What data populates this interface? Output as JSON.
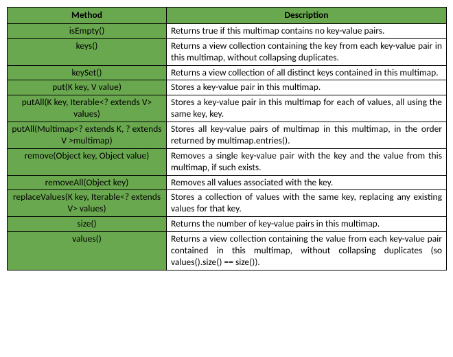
{
  "headers": {
    "method": "Method",
    "description": "Description"
  },
  "rows": [
    {
      "method": "isEmpty()",
      "description": "Returns true if this multimap contains no key-value pairs."
    },
    {
      "method": "keys()",
      "description": "Returns a view collection containing the key from each key-value pair in this multimap, without collapsing duplicates."
    },
    {
      "method": "keySet()",
      "description": "Returns a view collection of all distinct keys contained in this multimap."
    },
    {
      "method": "put(K key, V value)",
      "description": "Stores a key-value pair in this multimap."
    },
    {
      "method": "putAll(K key, Iterable<? extends V> values)",
      "description": "Stores a key-value pair in this multimap for each of values, all using the same key, key."
    },
    {
      "method": "putAll(Multimap<? extends K, ? extends V >multimap)",
      "description": "Stores all key-value pairs of multimap in this multimap, in the order returned by multimap.entries()."
    },
    {
      "method": "remove(Object key, Object value)",
      "description": "Removes a single key-value pair with the key and the value from this multimap, if such exists."
    },
    {
      "method": "removeAll(Object key)",
      "description": "Removes all values associated with the key."
    },
    {
      "method": "replaceValues(K key, Iterable<? extends V> values)",
      "description": "Stores a collection of values with the same key, replacing any existing values for that key."
    },
    {
      "method": "size()",
      "description": "Returns the number of key-value pairs in this multimap."
    },
    {
      "method": "values()",
      "description": "Returns a view collection containing the value from each key-value pair contained in this multimap, without collapsing duplicates (so values().size() == size())."
    }
  ]
}
